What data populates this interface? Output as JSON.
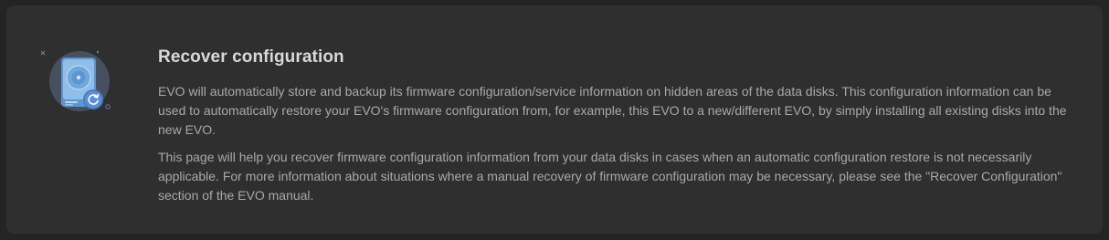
{
  "section": {
    "title": "Recover configuration",
    "paragraphs": [
      "EVO will automatically store and backup its firmware configuration/service information on hidden areas of the data disks. This configuration information can be used to automatically restore your EVO's firmware configuration from, for example, this EVO to a new/different EVO, by simply installing all existing disks into the new EVO.",
      "This page will help you recover firmware configuration information from your data disks in cases when an automatic configuration restore is not necessarily applicable. For more information about situations where a manual recovery of firmware configuration may be necessary, please see the \"Recover Configuration\" section of the EVO manual."
    ]
  },
  "illustration": {
    "icon": "disk-recover-icon",
    "colors": {
      "circle_bg": "#46505e",
      "disk_body": "#6fa8dc",
      "disk_face": "#8fbfe8",
      "badge": "#5b8fd6"
    }
  }
}
